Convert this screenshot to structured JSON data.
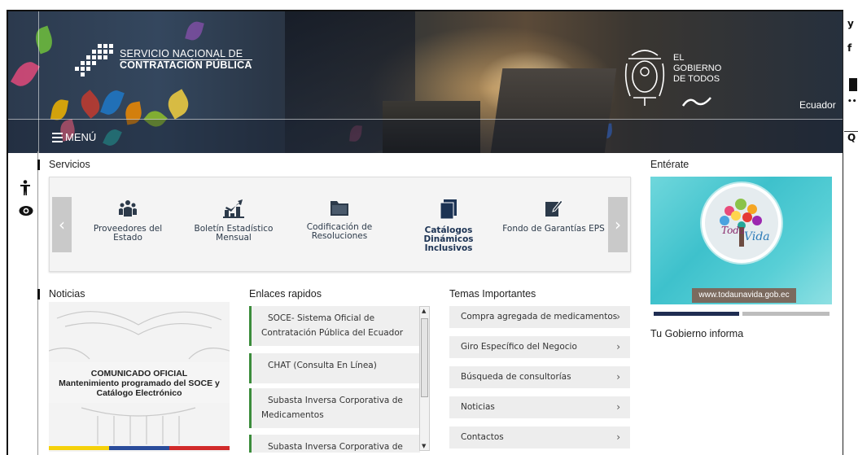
{
  "header": {
    "logo_line1": "SERVICIO NACIONAL DE",
    "logo_line2": "CONTRATACIÓN PÚBLICA",
    "gob_line1": "EL",
    "gob_line2": "GOBIERNO",
    "gob_line3": "DE TODOS",
    "country": "Ecuador",
    "menu_label": "MENÚ"
  },
  "social": {
    "twitter": "y",
    "facebook": "f",
    "flickr": "••",
    "search": "Q"
  },
  "servicios": {
    "title": "Servicios",
    "items": [
      {
        "label": "Proveedores del Estado",
        "icon": "users-icon"
      },
      {
        "label": "Boletín Estadístico Mensual",
        "icon": "chart-icon"
      },
      {
        "label": "Codificación de Resoluciones",
        "icon": "folder-icon"
      },
      {
        "label": "Catálogos Dinámicos Inclusivos",
        "icon": "book-icon"
      },
      {
        "label": "Fondo de Garantías EPS",
        "icon": "edit-icon"
      }
    ]
  },
  "enterate": {
    "title": "Entérate",
    "url_text": "www.todaunavida.gob.ec",
    "caption": "Toda una Vida"
  },
  "tu_gobierno": {
    "title": "Tu Gobierno informa"
  },
  "noticias": {
    "title": "Noticias",
    "overlay_line1": "COMUNICADO OFICIAL",
    "overlay_line2": "Mantenimiento programado del SOCE y",
    "overlay_line3": "Catálogo Electrónico"
  },
  "enlaces": {
    "title": "Enlaces rapidos",
    "items": [
      "SOCE- Sistema Oficial de Contratación Pública del Ecuador",
      "CHAT (Consulta En Línea)",
      "Subasta Inversa Corporativa de Medicamentos",
      "Subasta Inversa Corporativa de"
    ]
  },
  "temas": {
    "title": "Temas Importantes",
    "items": [
      "Compra agregada de medicamentos",
      "Giro Específico del Negocio",
      "Búsqueda de consultorías",
      "Noticias",
      "Contactos"
    ]
  },
  "colors": {
    "accent_green": "#3b8c3b",
    "flag_yellow": "#f5d10a",
    "flag_blue": "#2a4c9b",
    "flag_red": "#d12a2a",
    "navy": "#1c3354"
  }
}
